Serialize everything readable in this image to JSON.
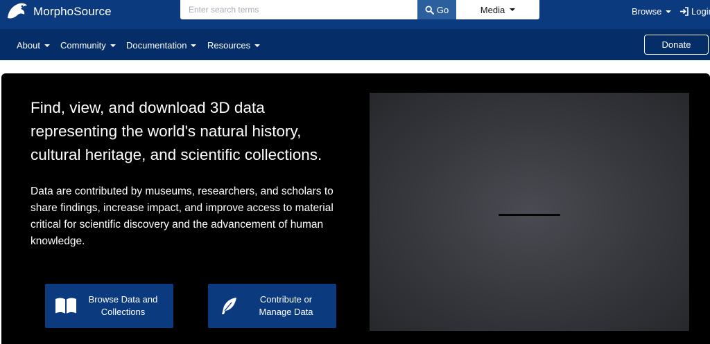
{
  "header": {
    "logo_text": "MorphoSource",
    "search_placeholder": "Enter search terms",
    "go_label": "Go",
    "media_label": "Media",
    "browse_label": "Browse",
    "login_label": "Login"
  },
  "nav": {
    "items": [
      "About",
      "Community",
      "Documentation",
      "Resources"
    ],
    "donate_label": "Donate"
  },
  "hero": {
    "headline": "Find, view, and download 3D data representing the world's natural history, cultural heritage, and scientific collections.",
    "subtext": "Data are contributed by museums, researchers, and scholars to share findings, increase impact, and improve access to material critical for scientific discovery and the advancement of human knowledge.",
    "buttons": {
      "browse_line1": "Browse Data and",
      "browse_line2": "Collections",
      "contribute_line1": "Contribute or",
      "contribute_line2": "Manage Data"
    }
  },
  "colors": {
    "header_bg": "#0b3a7e",
    "nav_bg": "#052e68",
    "go_bg": "#2b5f9e",
    "hero_bg": "#000000"
  },
  "icons": [
    "morphosource-logo",
    "search-icon",
    "caret-down-icon",
    "login-icon",
    "open-book-icon",
    "feather-icon"
  ]
}
